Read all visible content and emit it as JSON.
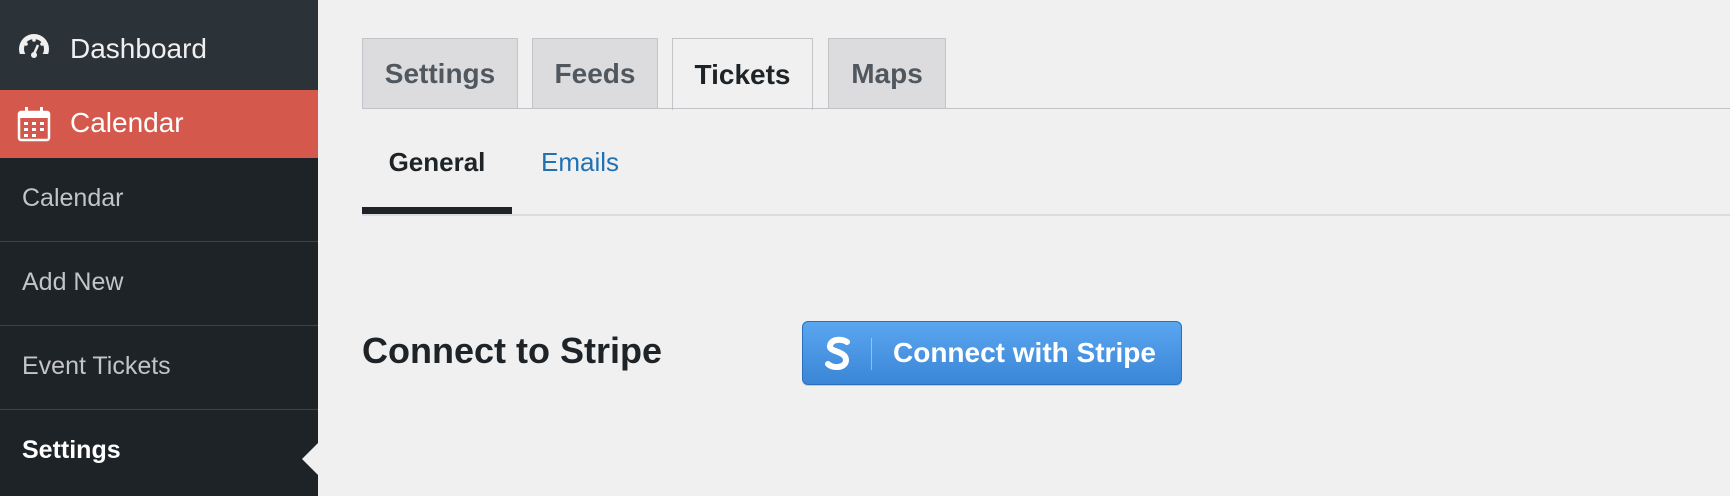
{
  "sidebar": {
    "dashboard_label": "Dashboard",
    "calendar_label": "Calendar",
    "submenu": [
      {
        "label": "Calendar"
      },
      {
        "label": "Add New"
      },
      {
        "label": "Event Tickets"
      },
      {
        "label": "Settings"
      }
    ],
    "colors": {
      "background": "#1d2327",
      "active": "#d4584b"
    }
  },
  "tabs": [
    {
      "label": "Settings"
    },
    {
      "label": "Feeds"
    },
    {
      "label": "Tickets"
    },
    {
      "label": "Maps"
    }
  ],
  "active_tab": "Tickets",
  "subtabs": [
    {
      "label": "General"
    },
    {
      "label": "Emails"
    }
  ],
  "active_subtab": "General",
  "section": {
    "title": "Connect to Stripe",
    "button_label": "Connect with Stripe",
    "button_icon": "stripe-s-icon",
    "button_color": "#3a86d7"
  }
}
